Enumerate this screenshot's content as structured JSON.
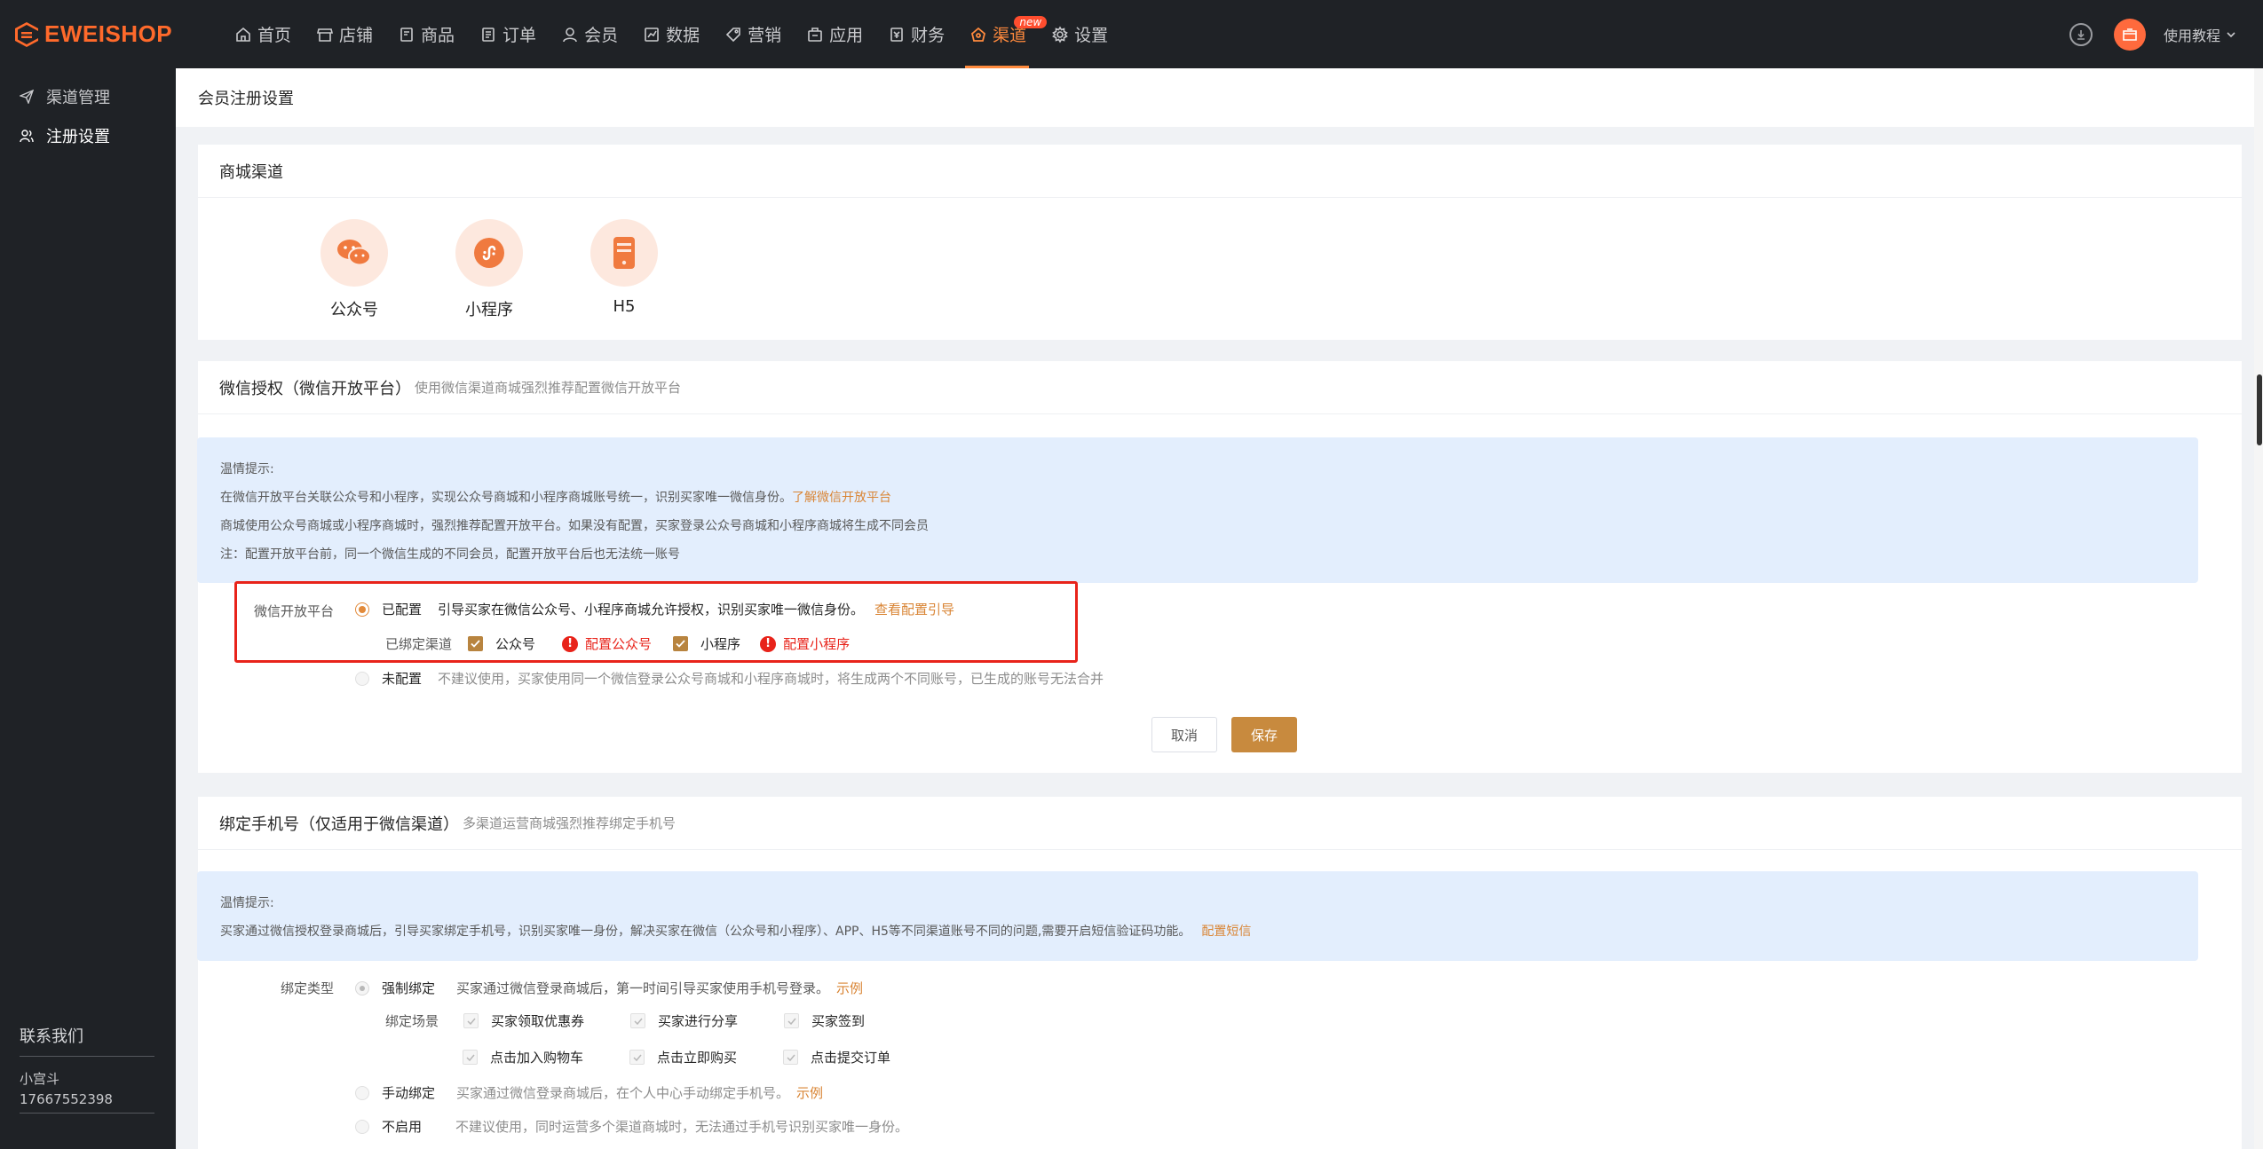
{
  "brand": {
    "logo_text": "EWEISHOP",
    "accent": "#ff6a2b"
  },
  "nav": [
    {
      "label": "首页",
      "icon": "home-icon"
    },
    {
      "label": "店铺",
      "icon": "shop-icon"
    },
    {
      "label": "商品",
      "icon": "goods-icon"
    },
    {
      "label": "订单",
      "icon": "order-icon"
    },
    {
      "label": "会员",
      "icon": "member-icon"
    },
    {
      "label": "数据",
      "icon": "chart-icon"
    },
    {
      "label": "营销",
      "icon": "tag-icon"
    },
    {
      "label": "应用",
      "icon": "app-icon"
    },
    {
      "label": "财务",
      "icon": "finance-icon"
    },
    {
      "label": "渠道",
      "icon": "channel-icon",
      "badge": "new",
      "active": true
    },
    {
      "label": "设置",
      "icon": "gear-icon"
    }
  ],
  "topbar": {
    "help_label": "使用教程"
  },
  "sidebar": {
    "items": [
      {
        "label": "渠道管理",
        "icon": "send-icon"
      },
      {
        "label": "注册设置",
        "icon": "users-icon",
        "active": true
      }
    ],
    "contact": {
      "title": "联系我们",
      "name": "小宫斗",
      "phone": "17667552398"
    }
  },
  "page": {
    "title": "会员注册设置"
  },
  "channels": {
    "title": "商城渠道",
    "items": [
      {
        "label": "公众号",
        "icon": "wechat-icon"
      },
      {
        "label": "小程序",
        "icon": "miniprogram-icon"
      },
      {
        "label": "H5",
        "icon": "mobile-icon"
      }
    ]
  },
  "wechat_auth": {
    "title": "微信授权（微信开放平台）",
    "subtitle": "使用微信渠道商城强烈推荐配置微信开放平台",
    "tip_title": "温情提示:",
    "tip_line1": "在微信开放平台关联公众号和小程序，实现公众号商城和小程序商城账号统一，识别买家唯一微信身份。",
    "tip_line1_link": "了解微信开放平台",
    "tip_line2": "商城使用公众号商城或小程序商城时，强烈推荐配置开放平台。如果没有配置，买家登录公众号商城和小程序商城将生成不同会员",
    "tip_line3": "注：配置开放平台前，同一个微信生成的不同会员，配置开放平台后也无法统一账号",
    "field_label": "微信开放平台",
    "opt_configured": "已配置",
    "opt_configured_desc": "引导买家在微信公众号、小程序商城允许授权，识别买家唯一微信身份。",
    "opt_configured_link": "查看配置引导",
    "bound_label": "已绑定渠道",
    "bound_gzh": "公众号",
    "bound_gzh_link": "配置公众号",
    "bound_mp": "小程序",
    "bound_mp_link": "配置小程序",
    "opt_not": "未配置",
    "opt_not_desc": "不建议使用，买家使用同一个微信登录公众号商城和小程序商城时，将生成两个不同账号，已生成的账号无法合并",
    "btn_cancel": "取消",
    "btn_save": "保存"
  },
  "phone_bind": {
    "title": "绑定手机号（仅适用于微信渠道）",
    "subtitle": "多渠道运营商城强烈推荐绑定手机号",
    "tip_title": "温情提示:",
    "tip_line1": "买家通过微信授权登录商城后，引导买家绑定手机号，识别买家唯一身份，解决买家在微信（公众号和小程序）、APP、H5等不同渠道账号不同的问题,需要开启短信验证码功能。",
    "tip_line1_link": "配置短信",
    "type_label": "绑定类型",
    "opt_force": "强制绑定",
    "opt_force_desc": "买家通过微信登录商城后，第一时间引导买家使用手机号登录。",
    "opt_force_link": "示例",
    "scene_label": "绑定场景",
    "scenes": [
      "买家领取优惠券",
      "买家进行分享",
      "买家签到",
      "点击加入购物车",
      "点击立即购买",
      "点击提交订单"
    ],
    "opt_manual": "手动绑定",
    "opt_manual_desc": "买家通过微信登录商城后，在个人中心手动绑定手机号。",
    "opt_manual_link": "示例",
    "opt_off": "不启用",
    "opt_off_desc": "不建议使用，同时运营多个渠道商城时，无法通过手机号识别买家唯一身份。"
  }
}
